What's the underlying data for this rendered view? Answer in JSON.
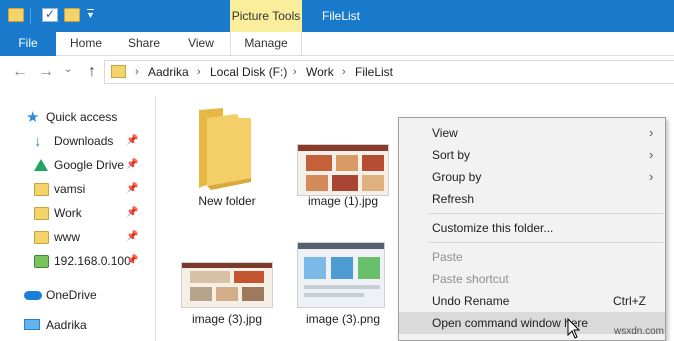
{
  "titlebar": {
    "contextual_tab": "Picture Tools",
    "window_title": "FileList",
    "background": "#1979ca",
    "contextual_color": "#f8ee9c"
  },
  "ribbon": {
    "tabs": [
      {
        "label": "File"
      },
      {
        "label": "Home"
      },
      {
        "label": "Share"
      },
      {
        "label": "View"
      },
      {
        "label": "Manage"
      }
    ]
  },
  "navigation": {
    "back_icon": "arrow-left-icon",
    "forward_icon": "arrow-right-icon",
    "recent_icon": "chevron-down-icon",
    "up_icon": "arrow-up-icon",
    "breadcrumb": [
      "Aadrika",
      "Local Disk (F:)",
      "Work",
      "FileList"
    ]
  },
  "sidebar": {
    "items": [
      {
        "label": "Quick access",
        "icon": "star-icon",
        "pinned": false
      },
      {
        "label": "Downloads",
        "icon": "download-icon",
        "pinned": true
      },
      {
        "label": "Google Drive",
        "icon": "google-drive-icon",
        "pinned": true
      },
      {
        "label": "vamsi",
        "icon": "folder-icon",
        "pinned": true
      },
      {
        "label": "Work",
        "icon": "folder-icon",
        "pinned": true
      },
      {
        "label": "www",
        "icon": "folder-icon",
        "pinned": true
      },
      {
        "label": "192.168.0.100",
        "icon": "network-drive-icon",
        "pinned": true
      },
      {
        "label": "OneDrive",
        "icon": "cloud-icon",
        "pinned": false
      },
      {
        "label": "Aadrika",
        "icon": "computer-icon",
        "pinned": false
      }
    ]
  },
  "files": [
    {
      "name": "New folder",
      "kind": "folder"
    },
    {
      "name": "image (1).jpg",
      "kind": "image"
    },
    {
      "name": "image (3).jpg",
      "kind": "image"
    },
    {
      "name": "image (3).png",
      "kind": "image"
    }
  ],
  "context_menu": {
    "items": [
      {
        "label": "View",
        "submenu": true,
        "enabled": true
      },
      {
        "label": "Sort by",
        "submenu": true,
        "enabled": true
      },
      {
        "label": "Group by",
        "submenu": true,
        "enabled": true
      },
      {
        "label": "Refresh",
        "submenu": false,
        "enabled": true
      },
      {
        "label": "Customize this folder...",
        "submenu": false,
        "enabled": true
      },
      {
        "label": "Paste",
        "submenu": false,
        "enabled": false
      },
      {
        "label": "Paste shortcut",
        "submenu": false,
        "enabled": false
      },
      {
        "label": "Undo Rename",
        "shortcut": "Ctrl+Z",
        "submenu": false,
        "enabled": true
      },
      {
        "label": "Open command window here",
        "submenu": false,
        "enabled": true,
        "highlighted": true
      }
    ]
  },
  "watermark": "wsxdn.com"
}
